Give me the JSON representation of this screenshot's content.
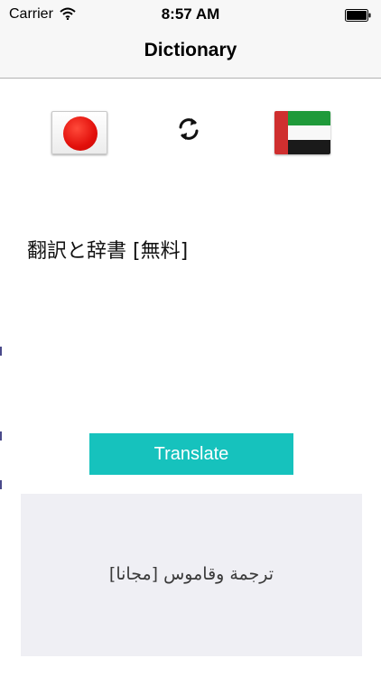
{
  "status_bar": {
    "carrier": "Carrier",
    "time": "8:57 AM"
  },
  "nav": {
    "title": "Dictionary"
  },
  "languages": {
    "source_flag": "japan-flag-icon",
    "target_flag": "uae-flag-icon",
    "swap_icon": "swap-arrows-icon"
  },
  "input": {
    "text": "翻訳と辞書 [無料]"
  },
  "actions": {
    "translate_label": "Translate"
  },
  "result": {
    "text": "ترجمة وقاموس [مجانا]"
  },
  "colors": {
    "accent": "#16c2bd",
    "result_background": "#efeff4"
  }
}
